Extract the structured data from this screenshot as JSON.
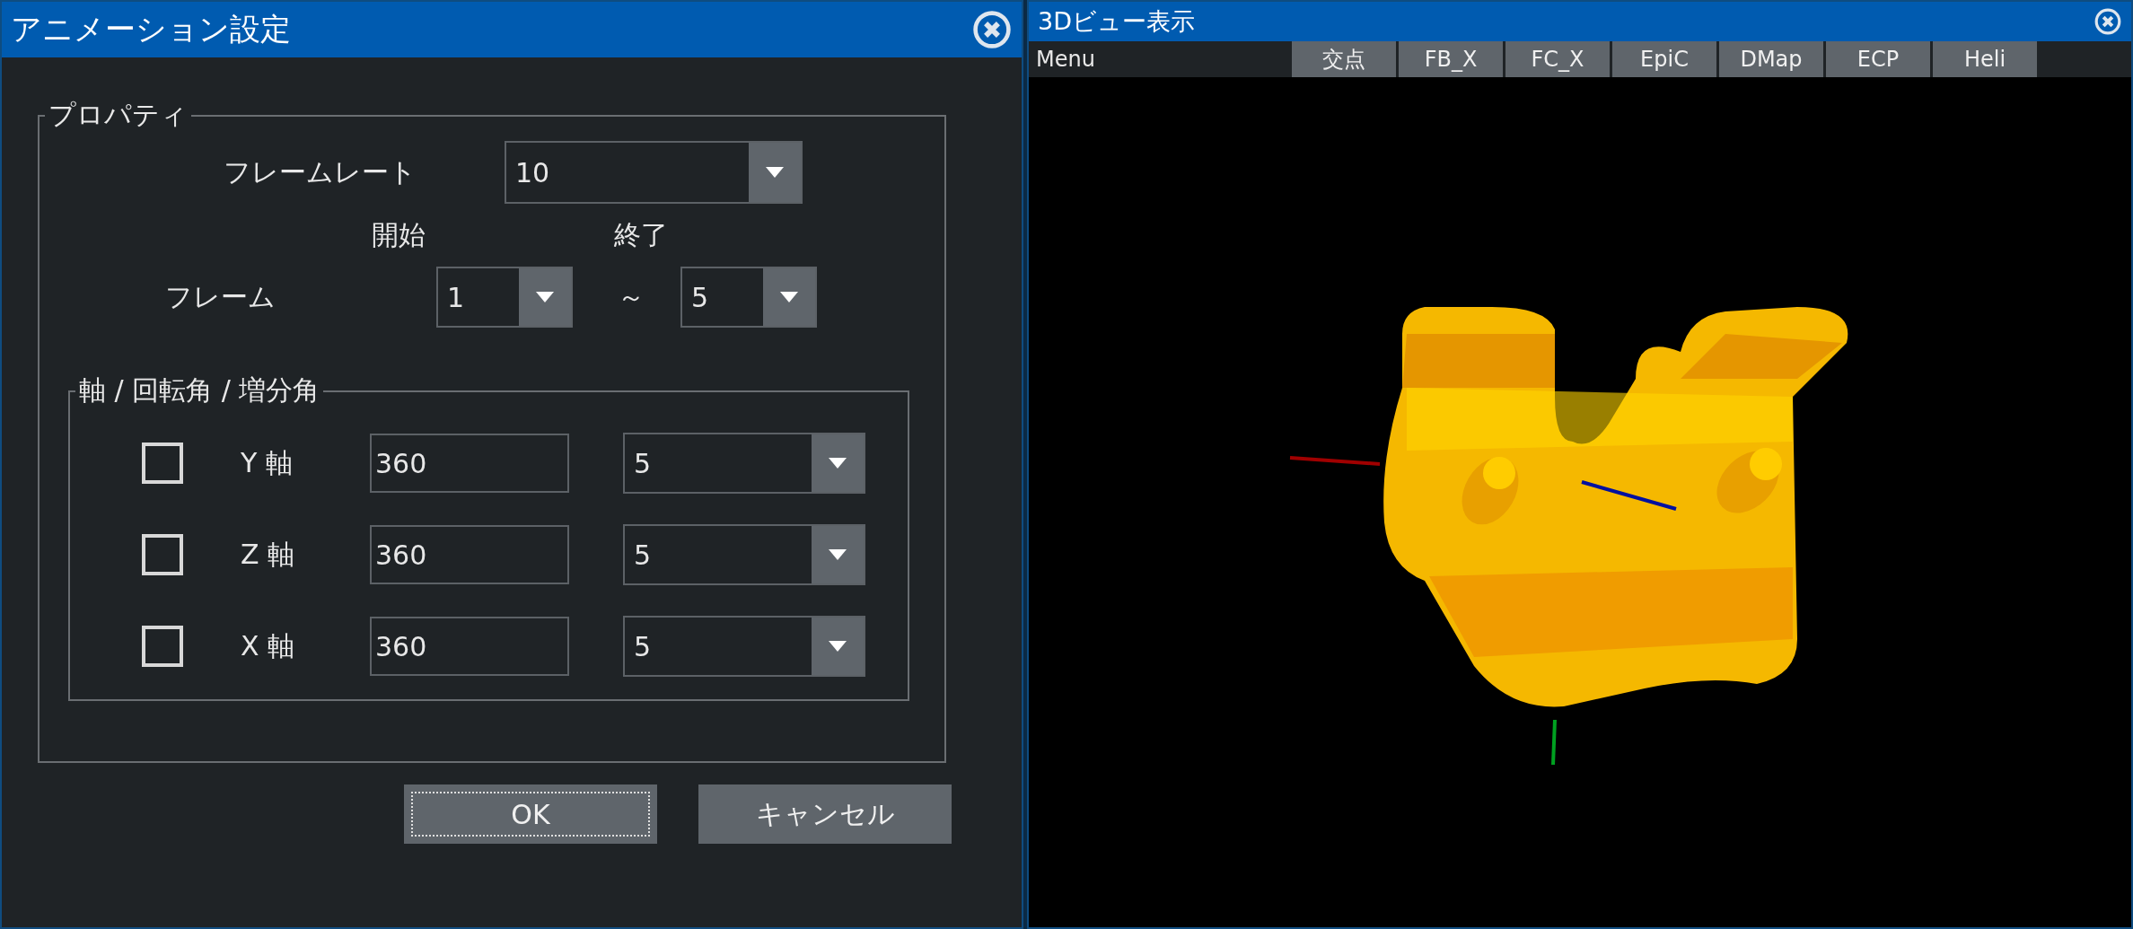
{
  "dialog": {
    "title": "アニメーション設定",
    "group": "プロパティ",
    "frame_rate": {
      "label": "フレームレート",
      "value": "10"
    },
    "frame": {
      "label": "フレーム",
      "start_heading": "開始",
      "end_heading": "終了",
      "start": "1",
      "separator": "～",
      "end": "5"
    },
    "axes_group": {
      "title": "軸 / 回転角 / 増分角",
      "rows": [
        {
          "checked": false,
          "label": "Y 軸",
          "angle": "360",
          "step": "5"
        },
        {
          "checked": false,
          "label": "Z 軸",
          "angle": "360",
          "step": "5"
        },
        {
          "checked": false,
          "label": "X 軸",
          "angle": "360",
          "step": "5"
        }
      ]
    },
    "buttons": [
      {
        "label": "OK",
        "focused": true
      },
      {
        "label": "キャンセル",
        "focused": false
      }
    ]
  },
  "view": {
    "title": "3Dビュー表示",
    "menu": "Menu",
    "tools": [
      "交点",
      "FB_X",
      "FC_X",
      "EpiC",
      "DMap",
      "ECP",
      "Heli"
    ]
  }
}
